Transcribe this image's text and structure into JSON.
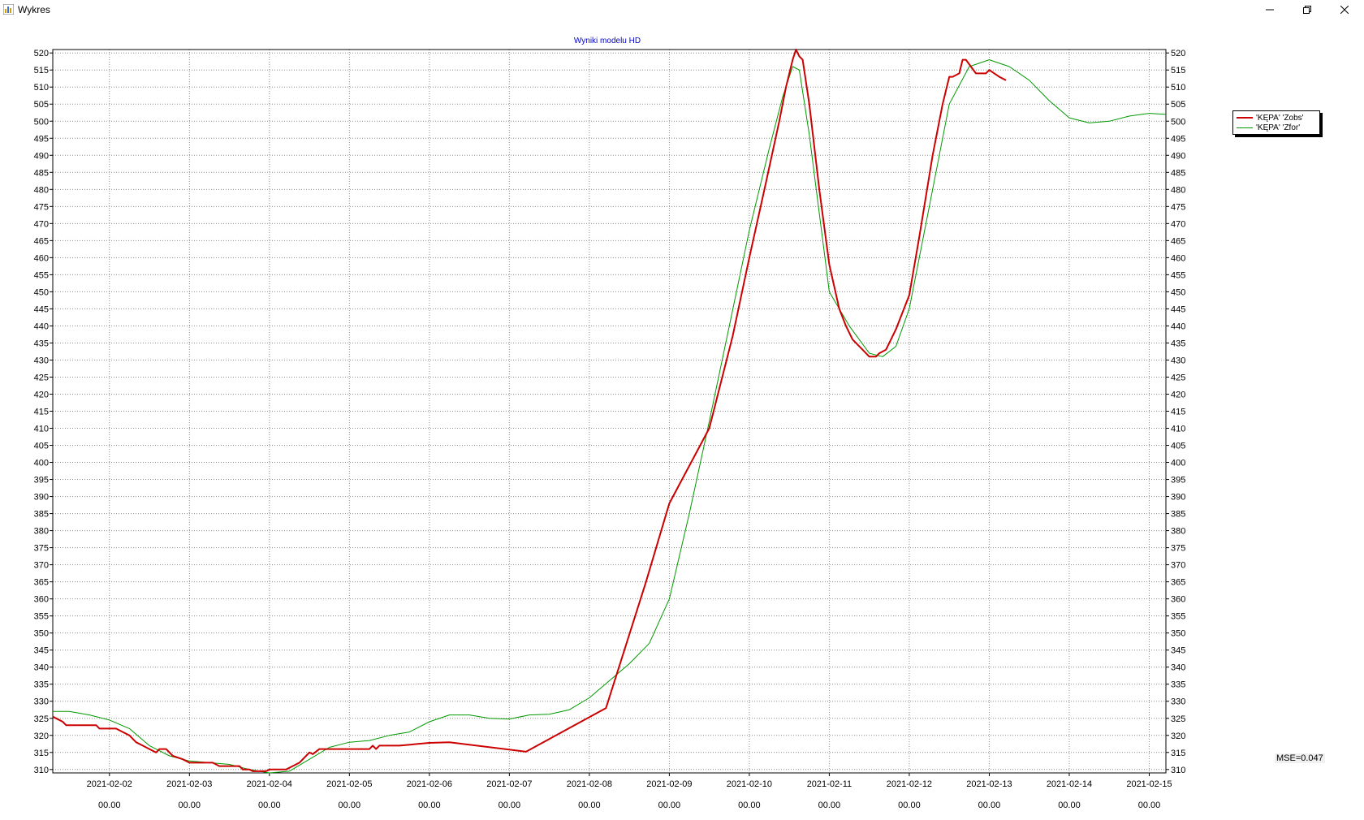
{
  "window": {
    "title": "Wykres",
    "icons": [
      "app-icon",
      "minimize-icon",
      "restore-icon",
      "close-icon"
    ]
  },
  "chart_data": {
    "type": "line",
    "title": "Wyniki modelu HD",
    "title_color": "#0000cc",
    "xlabel": "",
    "ylabel": "",
    "grid": true,
    "legend_position": "right",
    "ylim": [
      309,
      521
    ],
    "xlim": [
      "2021-02-01 07:00",
      "2021-02-15 05:00"
    ],
    "y_ticks": [
      310,
      315,
      320,
      325,
      330,
      335,
      340,
      345,
      350,
      355,
      360,
      365,
      370,
      375,
      380,
      385,
      390,
      395,
      400,
      405,
      410,
      415,
      420,
      425,
      430,
      435,
      440,
      445,
      450,
      455,
      460,
      465,
      470,
      475,
      480,
      485,
      490,
      495,
      500,
      505,
      510,
      515,
      520
    ],
    "x_ticks": [
      {
        "date": "2021-02-02",
        "time": "00.00"
      },
      {
        "date": "2021-02-03",
        "time": "00.00"
      },
      {
        "date": "2021-02-04",
        "time": "00.00"
      },
      {
        "date": "2021-02-05",
        "time": "00.00"
      },
      {
        "date": "2021-02-06",
        "time": "00.00"
      },
      {
        "date": "2021-02-07",
        "time": "00.00"
      },
      {
        "date": "2021-02-08",
        "time": "00.00"
      },
      {
        "date": "2021-02-09",
        "time": "00.00"
      },
      {
        "date": "2021-02-10",
        "time": "00.00"
      },
      {
        "date": "2021-02-11",
        "time": "00.00"
      },
      {
        "date": "2021-02-12",
        "time": "00.00"
      },
      {
        "date": "2021-02-13",
        "time": "00.00"
      },
      {
        "date": "2021-02-14",
        "time": "00.00"
      },
      {
        "date": "2021-02-15",
        "time": "00.00"
      }
    ],
    "series": [
      {
        "name": "'KĘPA' 'Zobs'",
        "color": "#cc0000",
        "points": [
          [
            "2021-02-01 07:00",
            325.5
          ],
          [
            "2021-02-01 08:00",
            325
          ],
          [
            "2021-02-01 10:00",
            324
          ],
          [
            "2021-02-01 11:00",
            323
          ],
          [
            "2021-02-01 20:00",
            323
          ],
          [
            "2021-02-01 21:00",
            322
          ],
          [
            "2021-02-02 02:00",
            322
          ],
          [
            "2021-02-02 04:00",
            321
          ],
          [
            "2021-02-02 06:00",
            320
          ],
          [
            "2021-02-02 08:00",
            318
          ],
          [
            "2021-02-02 10:00",
            317
          ],
          [
            "2021-02-02 12:00",
            316
          ],
          [
            "2021-02-02 14:00",
            315
          ],
          [
            "2021-02-02 15:00",
            316
          ],
          [
            "2021-02-02 17:00",
            316
          ],
          [
            "2021-02-02 19:00",
            314
          ],
          [
            "2021-02-02 22:00",
            313
          ],
          [
            "2021-02-03 00:00",
            312
          ],
          [
            "2021-02-03 07:00",
            312
          ],
          [
            "2021-02-03 09:00",
            311
          ],
          [
            "2021-02-03 15:00",
            311
          ],
          [
            "2021-02-03 16:00",
            310
          ],
          [
            "2021-02-03 18:00",
            310
          ],
          [
            "2021-02-03 19:00",
            309.5
          ],
          [
            "2021-02-03 23:00",
            309.5
          ],
          [
            "2021-02-04 00:00",
            310
          ],
          [
            "2021-02-04 05:00",
            310
          ],
          [
            "2021-02-04 07:00",
            311
          ],
          [
            "2021-02-04 09:00",
            312
          ],
          [
            "2021-02-04 11:00",
            314
          ],
          [
            "2021-02-04 12:00",
            315
          ],
          [
            "2021-02-04 13:00",
            314.5
          ],
          [
            "2021-02-04 15:00",
            316
          ],
          [
            "2021-02-04 17:00",
            316
          ],
          [
            "2021-02-05 06:00",
            316
          ],
          [
            "2021-02-05 07:00",
            317
          ],
          [
            "2021-02-05 08:00",
            316
          ],
          [
            "2021-02-05 09:00",
            317
          ],
          [
            "2021-02-05 15:00",
            317
          ],
          [
            "2021-02-06 00:00",
            317.8
          ],
          [
            "2021-02-06 06:00",
            318
          ],
          [
            "2021-02-07 05:00",
            315.2
          ],
          [
            "2021-02-08 05:00",
            328
          ],
          [
            "2021-02-08 17:00",
            365
          ],
          [
            "2021-02-09 00:00",
            388
          ],
          [
            "2021-02-09 12:00",
            410
          ],
          [
            "2021-02-09 19:00",
            437
          ],
          [
            "2021-02-10 00:00",
            460
          ],
          [
            "2021-02-10 05:00",
            482
          ],
          [
            "2021-02-10 09:00",
            500
          ],
          [
            "2021-02-10 11:00",
            510
          ],
          [
            "2021-02-10 13:00",
            518
          ],
          [
            "2021-02-10 14:00",
            521
          ],
          [
            "2021-02-10 15:00",
            519
          ],
          [
            "2021-02-10 16:00",
            518
          ],
          [
            "2021-02-10 18:00",
            505
          ],
          [
            "2021-02-10 21:00",
            480
          ],
          [
            "2021-02-11 00:00",
            458
          ],
          [
            "2021-02-11 03:00",
            445
          ],
          [
            "2021-02-11 05:00",
            440
          ],
          [
            "2021-02-11 07:00",
            436
          ],
          [
            "2021-02-11 10:00",
            433
          ],
          [
            "2021-02-11 12:00",
            431
          ],
          [
            "2021-02-11 14:00",
            431
          ],
          [
            "2021-02-11 15:00",
            432
          ],
          [
            "2021-02-11 17:00",
            433
          ],
          [
            "2021-02-11 20:00",
            439
          ],
          [
            "2021-02-12 00:00",
            449
          ],
          [
            "2021-02-12 03:00",
            466
          ],
          [
            "2021-02-12 07:00",
            490
          ],
          [
            "2021-02-12 10:00",
            505
          ],
          [
            "2021-02-12 12:00",
            513
          ],
          [
            "2021-02-12 13:00",
            513
          ],
          [
            "2021-02-12 15:00",
            514
          ],
          [
            "2021-02-12 16:00",
            518
          ],
          [
            "2021-02-12 17:00",
            518
          ],
          [
            "2021-02-12 20:00",
            514
          ],
          [
            "2021-02-12 23:00",
            514
          ],
          [
            "2021-02-13 00:00",
            515
          ],
          [
            "2021-02-13 03:00",
            513
          ],
          [
            "2021-02-13 05:00",
            512
          ]
        ]
      },
      {
        "name": "'KĘPA' 'Zfor'",
        "color": "#009900",
        "points": [
          [
            "2021-02-01 07:00",
            327
          ],
          [
            "2021-02-01 12:00",
            327
          ],
          [
            "2021-02-01 18:00",
            326
          ],
          [
            "2021-02-02 00:00",
            324.5
          ],
          [
            "2021-02-02 06:00",
            322
          ],
          [
            "2021-02-02 12:00",
            317
          ],
          [
            "2021-02-02 18:00",
            314
          ],
          [
            "2021-02-03 00:00",
            312.5
          ],
          [
            "2021-02-03 06:00",
            312
          ],
          [
            "2021-02-03 12:00",
            311.5
          ],
          [
            "2021-02-03 18:00",
            310
          ],
          [
            "2021-02-04 00:00",
            309
          ],
          [
            "2021-02-04 06:00",
            309.5
          ],
          [
            "2021-02-04 12:00",
            313
          ],
          [
            "2021-02-04 18:00",
            316.5
          ],
          [
            "2021-02-05 00:00",
            318
          ],
          [
            "2021-02-05 06:00",
            318.5
          ],
          [
            "2021-02-05 12:00",
            320
          ],
          [
            "2021-02-05 18:00",
            321
          ],
          [
            "2021-02-06 00:00",
            324
          ],
          [
            "2021-02-06 06:00",
            326
          ],
          [
            "2021-02-06 12:00",
            326
          ],
          [
            "2021-02-06 18:00",
            325
          ],
          [
            "2021-02-07 00:00",
            324.8
          ],
          [
            "2021-02-07 06:00",
            326
          ],
          [
            "2021-02-07 12:00",
            326.2
          ],
          [
            "2021-02-07 18:00",
            327.5
          ],
          [
            "2021-02-08 00:00",
            331
          ],
          [
            "2021-02-08 06:00",
            336
          ],
          [
            "2021-02-08 12:00",
            341
          ],
          [
            "2021-02-08 18:00",
            347
          ],
          [
            "2021-02-09 00:00",
            360
          ],
          [
            "2021-02-09 06:00",
            385
          ],
          [
            "2021-02-09 12:00",
            412
          ],
          [
            "2021-02-09 18:00",
            440
          ],
          [
            "2021-02-10 00:00",
            468
          ],
          [
            "2021-02-10 06:00",
            492
          ],
          [
            "2021-02-10 10:00",
            507
          ],
          [
            "2021-02-10 13:00",
            516
          ],
          [
            "2021-02-10 15:00",
            515
          ],
          [
            "2021-02-10 18:00",
            496
          ],
          [
            "2021-02-11 00:00",
            450
          ],
          [
            "2021-02-11 06:00",
            440
          ],
          [
            "2021-02-11 12:00",
            432
          ],
          [
            "2021-02-11 16:00",
            431
          ],
          [
            "2021-02-11 20:00",
            434
          ],
          [
            "2021-02-12 00:00",
            445
          ],
          [
            "2021-02-12 06:00",
            475
          ],
          [
            "2021-02-12 12:00",
            505
          ],
          [
            "2021-02-12 18:00",
            516
          ],
          [
            "2021-02-13 00:00",
            518
          ],
          [
            "2021-02-13 06:00",
            516
          ],
          [
            "2021-02-13 12:00",
            512
          ],
          [
            "2021-02-13 18:00",
            506
          ],
          [
            "2021-02-14 00:00",
            501
          ],
          [
            "2021-02-14 06:00",
            499.5
          ],
          [
            "2021-02-14 12:00",
            500
          ],
          [
            "2021-02-14 18:00",
            501.5
          ],
          [
            "2021-02-15 00:00",
            502.3
          ],
          [
            "2021-02-15 05:00",
            502
          ]
        ]
      }
    ],
    "legend": [
      "'KĘPA' 'Zobs'",
      "'KĘPA' 'Zfor'"
    ],
    "annotation": "MSE=0.047"
  }
}
